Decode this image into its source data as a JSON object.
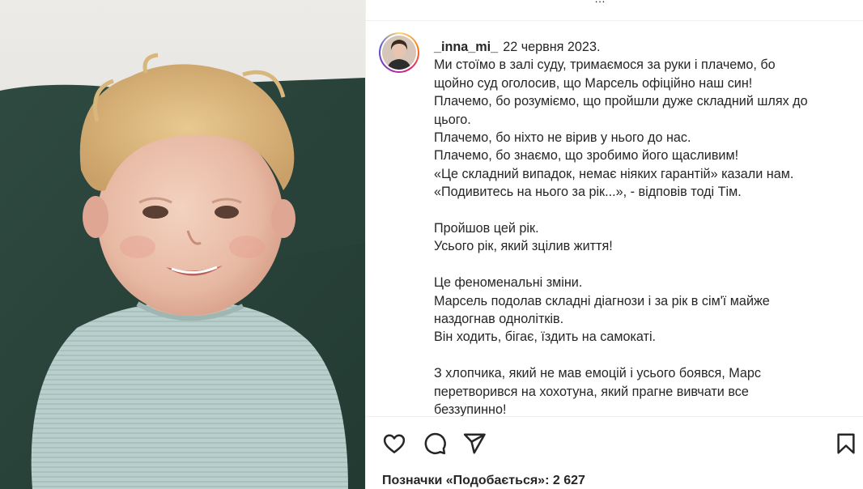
{
  "top_fragment": "…",
  "post": {
    "username": "_inna_mi_",
    "date": "22 червня 2023.",
    "caption_lines": [
      "Ми стоїмо в залі суду, тримаємося за руки і плачемо, бо",
      "щойно суд оголосив, що Марсель офіційно наш син!",
      "Плачемо, бо розуміємо, що пройшли дуже складний шлях до",
      "цього.",
      "Плачемо, бо ніхто не вірив у нього до нас.",
      "Плачемо, бо знаємо, що зробимо його щасливим!",
      "«Це складний випадок, немає ніяких гарантій» казали нам.",
      "«Подивитесь на нього за рік...», - відповів тоді Тім.",
      "",
      "Пройшов цей рік.",
      "Усього рік, який зцілив життя!",
      "",
      "Це феноменальні зміни.",
      "Марсель подолав складні діагнози і за рік в сім'ї майже",
      "наздогнав однолітків.",
      "Він ходить, бігає, їздить на самокаті.",
      "",
      "З хлопчика, який не мав емоцій і усього боявся, Марс",
      "перетворився на хохотуна, який прагне вивчати все",
      "беззупинно!"
    ]
  },
  "actions": {
    "like_icon": "heart-icon",
    "comment_icon": "speech-bubble-icon",
    "share_icon": "paper-plane-icon",
    "save_icon": "bookmark-icon"
  },
  "likes_text": "Позначки «Подобається»: 2 627"
}
